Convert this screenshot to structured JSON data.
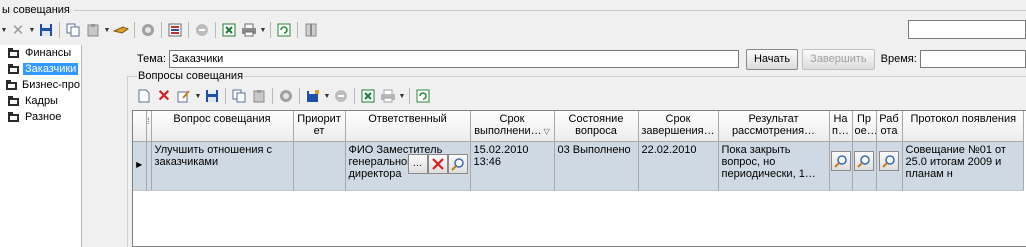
{
  "window": {
    "caption": "ы совещания"
  },
  "toolbar_top": {
    "icons": [
      "new-dropdown",
      "delete",
      "save",
      "copy",
      "paste",
      "hand-lookup",
      "refresh-circle",
      "list",
      "disabled-circle",
      "export-excel",
      "print",
      "reload",
      "split"
    ]
  },
  "tree": {
    "items": [
      {
        "label": "Финансы",
        "selected": false
      },
      {
        "label": "Заказчики",
        "selected": true
      },
      {
        "label": "Бизнес-про",
        "selected": false
      },
      {
        "label": "Кадры",
        "selected": false
      },
      {
        "label": "Разное",
        "selected": false
      }
    ]
  },
  "subject": {
    "label": "Тема:",
    "value": "Заказчики",
    "start_label": "Начать",
    "finish_label": "Завершить",
    "time_label": "Время:",
    "time_value": ""
  },
  "questions": {
    "title": "Вопросы совещания",
    "columns": [
      "Вопрос совещания",
      "Приорит ет",
      "Ответственный",
      "Срок выполнени…",
      "Состояние вопроса",
      "Срок завершения…",
      "Результат рассмотрения…",
      "На п…",
      "Пр ое…",
      "Раб ота",
      "Протокол появления"
    ],
    "rows": [
      {
        "question": "Улучшить отношения с заказчиками",
        "priority": "",
        "responsible": "ФИО Заместитель генеральног директора",
        "deadline": "15.02.2010 13:46",
        "state": "03 Выполнено",
        "finish_date": "22.02.2010",
        "result": "Пока закрыть вопрос, но периодически, 1…",
        "protocol": "Совещание №01 от 25.0 итогам 2009 и планам н"
      }
    ]
  },
  "colors": {
    "selection": "#3399ff",
    "row_selected": "#cfd9e4",
    "delete_red": "#d42020",
    "save_blue": "#1f4fa8",
    "excel_green": "#1e7b34"
  }
}
